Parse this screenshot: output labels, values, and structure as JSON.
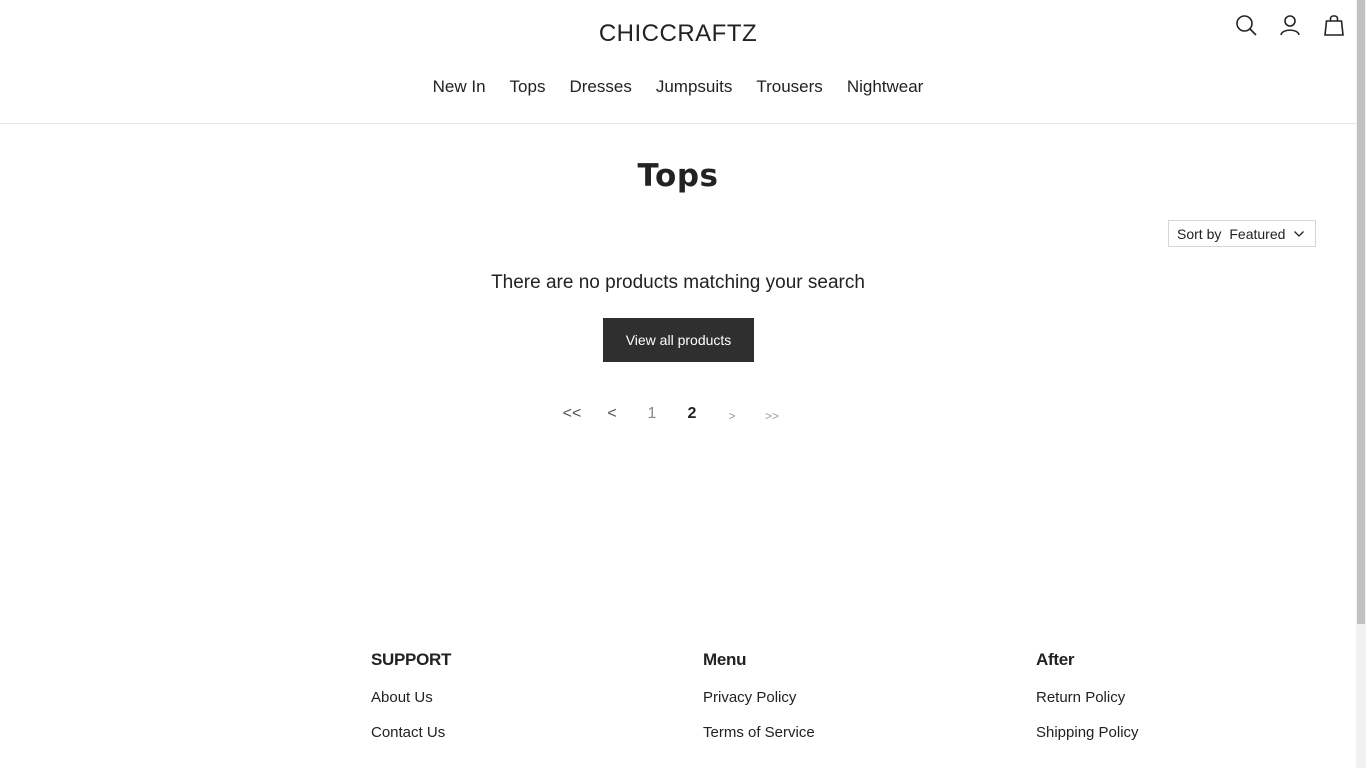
{
  "header": {
    "logo": "CHICCRAFTZ",
    "icons": [
      "search-icon",
      "account-icon",
      "bag-icon"
    ],
    "nav": [
      "New In",
      "Tops",
      "Dresses",
      "Jumpsuits",
      "Trousers",
      "Nightwear"
    ]
  },
  "main": {
    "title": "Tops",
    "sort": {
      "label": "Sort by",
      "value": "Featured"
    },
    "empty_message": "There are no products matching your search",
    "view_all_label": "View all products",
    "pagination": {
      "first": "<<",
      "prev": "<",
      "pages": [
        "1",
        "2"
      ],
      "current": "2",
      "next": ">",
      "last": ">>"
    }
  },
  "footer": {
    "columns": [
      {
        "heading": "SUPPORT",
        "links": [
          "About Us",
          "Contact Us"
        ]
      },
      {
        "heading": "Menu",
        "links": [
          "Privacy Policy",
          "Terms of Service"
        ]
      },
      {
        "heading": "After",
        "links": [
          "Return Policy",
          "Shipping Policy"
        ]
      }
    ]
  },
  "colors": {
    "text": "#222222",
    "button_bg": "#2f2f2f",
    "button_text": "#ffffff",
    "border": "#d6d6d6"
  }
}
